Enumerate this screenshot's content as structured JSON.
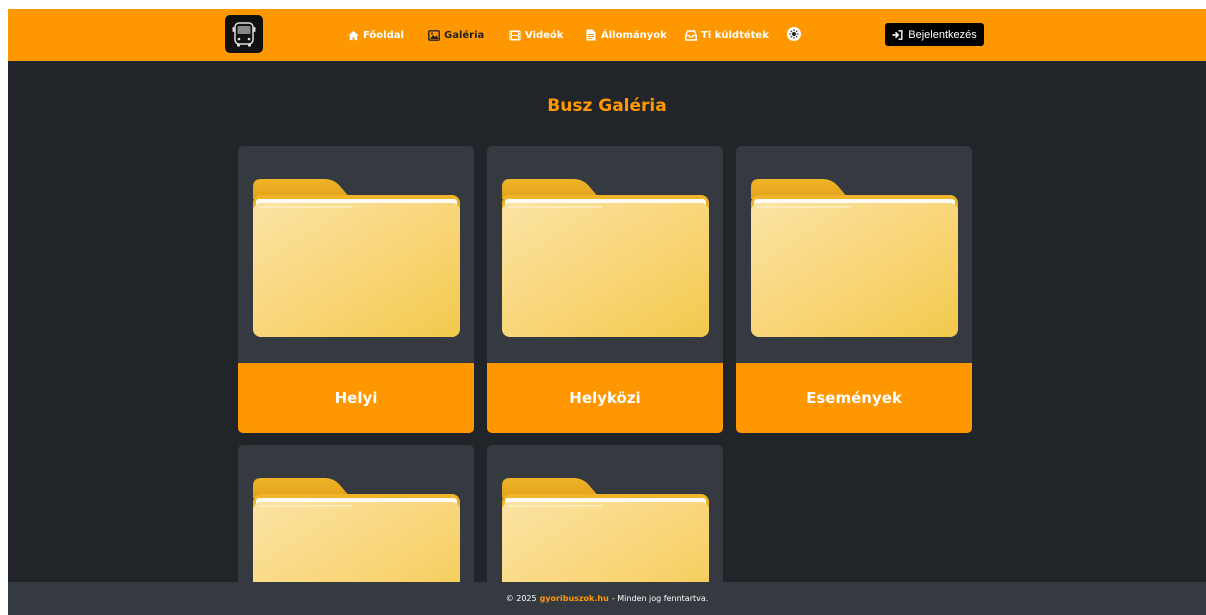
{
  "nav": {
    "links": [
      {
        "label": "Főoldal",
        "icon": "home-icon"
      },
      {
        "label": "Galéria",
        "icon": "image-icon"
      },
      {
        "label": "Videók",
        "icon": "film-icon"
      },
      {
        "label": "Állományok",
        "icon": "document-icon"
      },
      {
        "label": "Ti küldtétek",
        "icon": "inbox-icon"
      }
    ],
    "theme_toggle_icon": "sun-icon",
    "login_label": "Bejelentkezés",
    "login_icon": "sign-in-icon"
  },
  "page": {
    "title": "Busz Galéria"
  },
  "cards": [
    {
      "label": "Helyi",
      "icon": "folder-icon"
    },
    {
      "label": "Helyközi",
      "icon": "folder-icon"
    },
    {
      "label": "Események",
      "icon": "folder-icon"
    },
    {
      "label": "",
      "icon": "folder-icon"
    },
    {
      "label": "",
      "icon": "folder-icon"
    }
  ],
  "footer": {
    "copyright": "© 2025",
    "site": "gyoribuszok.hu",
    "rights": "- Minden jog fenntartva."
  },
  "colors": {
    "accent": "#ff9800",
    "background": "#212529",
    "card": "#343a40",
    "folder": "#f7d774"
  }
}
